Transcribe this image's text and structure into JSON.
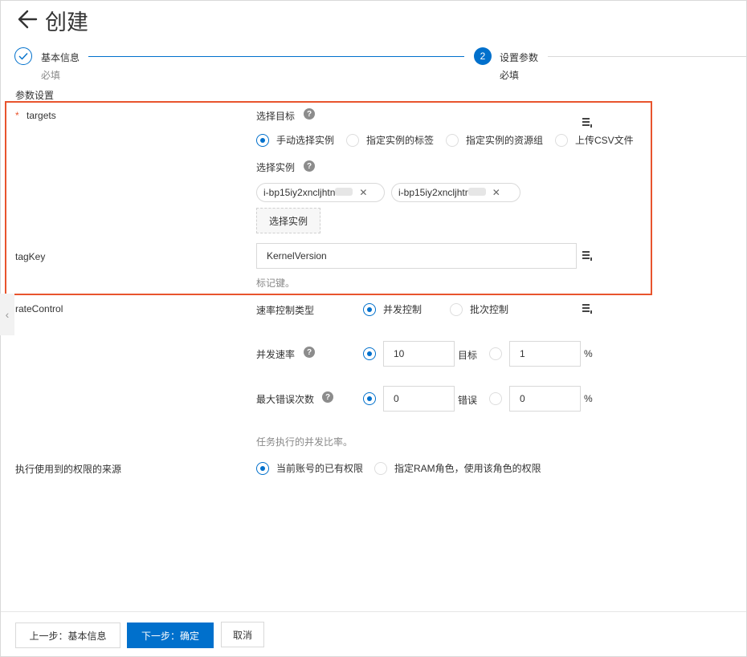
{
  "header": {
    "title": "创建"
  },
  "steps": [
    {
      "title": "基本信息",
      "subtitle": "必填",
      "status": "done"
    },
    {
      "number": "2",
      "title": "设置参数",
      "subtitle": "必填",
      "status": "active"
    }
  ],
  "section_title": "参数设置",
  "targets": {
    "required_mark": "*",
    "label": "targets",
    "select_target_label": "选择目标",
    "help": "?",
    "options": [
      "手动选择实例",
      "指定实例的标签",
      "指定实例的资源组",
      "上传CSV文件"
    ],
    "selected_index": 0,
    "select_instance_label": "选择实例",
    "instances": [
      "i-bp15iy2xncljhtn",
      "i-bp15iy2xncljhtr"
    ],
    "select_instance_button": "选择实例"
  },
  "tagKey": {
    "label": "tagKey",
    "value": "KernelVersion",
    "hint": "标记键。"
  },
  "rateControl": {
    "label": "rateControl",
    "type_label": "速率控制类型",
    "type_options": [
      "并发控制",
      "批次控制"
    ],
    "type_selected": 0,
    "concurrency_label": "并发速率",
    "concurrency_value": "10",
    "concurrency_unit": "目标",
    "concurrency_percent_value": "1",
    "percent_sign": "%",
    "max_errors_label": "最大错误次数",
    "max_errors_value": "0",
    "max_errors_unit": "错误",
    "max_errors_percent_value": "0",
    "hint": "任务执行的并发比率。"
  },
  "permission": {
    "label": "执行使用到的权限的来源",
    "options": [
      "当前账号的已有权限",
      "指定RAM角色，使用该角色的权限"
    ],
    "selected_index": 0
  },
  "footer": {
    "prev": "上一步：基本信息",
    "next": "下一步：确定",
    "cancel": "取消"
  },
  "colors": {
    "primary": "#0070cc",
    "highlight": "#e8542d"
  }
}
